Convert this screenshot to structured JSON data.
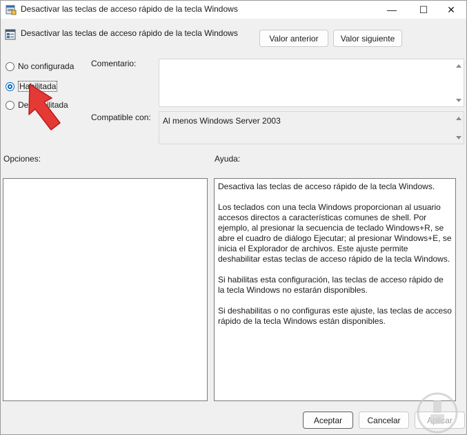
{
  "window": {
    "title": "Desactivar las teclas de acceso rápido de la tecla Windows",
    "minimize_glyph": "—",
    "maximize_glyph": "☐",
    "close_glyph": "✕"
  },
  "header": {
    "title": "Desactivar las teclas de acceso rápido de la tecla Windows",
    "prev_label": "Valor anterior",
    "next_label": "Valor siguiente"
  },
  "state": {
    "options": [
      {
        "label": "No configurada",
        "checked": false
      },
      {
        "label": "Habilitada",
        "checked": true
      },
      {
        "label": "Deshabilitada",
        "checked": false
      }
    ]
  },
  "fields": {
    "comment_label": "Comentario:",
    "comment_value": "",
    "compat_label": "Compatible con:",
    "compat_value": "Al menos Windows Server 2003"
  },
  "panels": {
    "options_label": "Opciones:",
    "help_label": "Ayuda:",
    "help_paragraphs": [
      "Desactiva las teclas de acceso rápido de la tecla Windows.",
      "Los teclados con una tecla Windows proporcionan al usuario accesos directos a características comunes de shell. Por ejemplo, al presionar la secuencia de teclado Windows+R, se abre el cuadro de diálogo Ejecutar; al presionar Windows+E, se inicia el Explorador de archivos. Este ajuste permite deshabilitar estas teclas de acceso rápido de la tecla Windows.",
      "Si habilitas esta configuración, las teclas de acceso rápido de la tecla Windows no estarán disponibles.",
      "Si deshabilitas o no configuras este ajuste, las teclas de acceso rápido de la tecla Windows están disponibles."
    ]
  },
  "footer": {
    "ok_label": "Aceptar",
    "cancel_label": "Cancelar",
    "apply_label": "Aplicar"
  },
  "icons": {
    "app": "policy-window-icon",
    "header": "policy-setting-icon",
    "annotation": "red-arrow-icon",
    "watermark": "watermark-logo-icon"
  },
  "colors": {
    "accent": "#0067c0",
    "arrow": "#e53935",
    "window_bg": "#f0f0f0"
  }
}
